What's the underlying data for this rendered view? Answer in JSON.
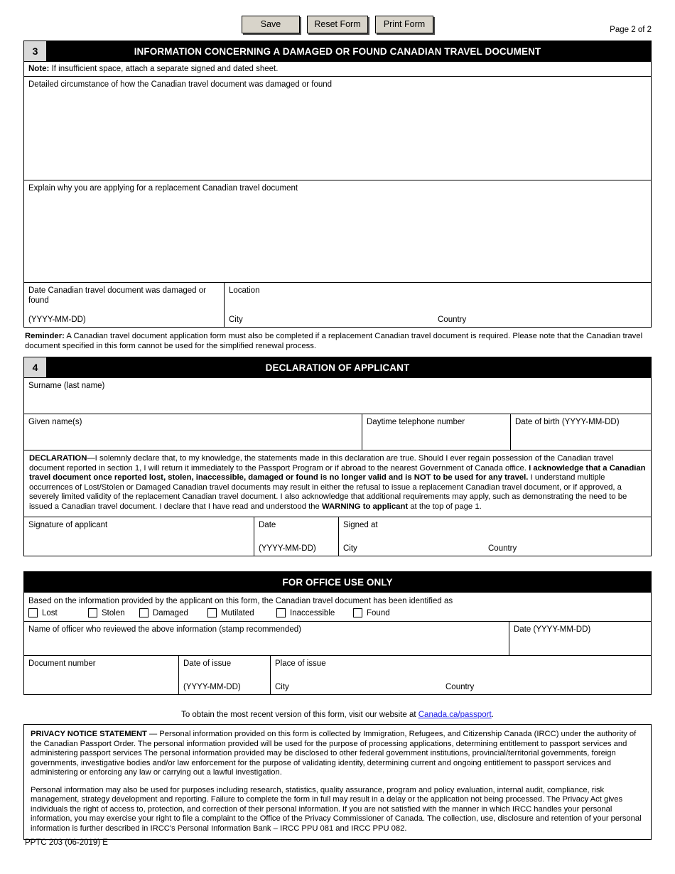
{
  "toolbar": {
    "save_label": "Save",
    "reset_label": "Reset Form",
    "print_label": "Print Form"
  },
  "page_indicator": "Page 2 of 2",
  "section3": {
    "number": "3",
    "title": "INFORMATION CONCERNING A DAMAGED OR FOUND CANADIAN TRAVEL DOCUMENT",
    "note_bold": "Note:",
    "note_text": " If insufficient space, attach a separate signed and dated sheet.",
    "field_circumstance": "Detailed circumstance of how the Canadian travel document was damaged or found",
    "field_explain": "Explain why you are applying for a replacement Canadian travel document",
    "field_date_label": "Date Canadian travel document was damaged or found",
    "field_date_format": "(YYYY-MM-DD)",
    "field_location_label": "Location",
    "field_city": "City",
    "field_country": "Country"
  },
  "reminder": {
    "bold": "Reminder:",
    "text": " A Canadian travel document application form must also be completed if a replacement Canadian travel document is required. Please note that the Canadian travel document specified in this form cannot be used for the simplified renewal process."
  },
  "section4": {
    "number": "4",
    "title": "DECLARATION OF APPLICANT",
    "field_surname": "Surname (last name)",
    "field_given_names": "Given name(s)",
    "field_phone": "Daytime telephone number",
    "field_dob": "Date of birth (YYYY-MM-DD)",
    "declaration": {
      "b1": "DECLARATION",
      "t1": "—I solemnly declare that, to my knowledge, the statements made in this declaration are true. Should I ever regain possession of the Canadian travel document reported in section 1, I will return it immediately to the Passport Program or if abroad to the nearest Government of Canada office. ",
      "b2": "I acknowledge that a Canadian travel document once reported lost, stolen, inaccessible, damaged or found is no longer valid and is NOT to be used for any travel.",
      "t2": " I understand multiple occurrences of Lost/Stolen or Damaged Canadian travel documents may result in either the refusal to issue a replacement Canadian travel document, or if approved, a severely limited validity of the replacement Canadian travel document. I also acknowledge that additional requirements may apply, such as demonstrating the need to be issued a Canadian travel document. I declare that I have read and understood the ",
      "b3": "WARNING to applicant",
      "t3": " at the top of page 1."
    },
    "field_signature": "Signature of applicant",
    "field_date": "Date",
    "field_date_format": "(YYYY-MM-DD)",
    "field_signed_at": "Signed at",
    "field_city": "City",
    "field_country": "Country"
  },
  "office_use": {
    "title": "FOR OFFICE USE ONLY",
    "identified_text": "Based on the information provided by the applicant on this form, the Canadian travel document has been identified as",
    "checkboxes": [
      {
        "label": "Lost",
        "checked": false
      },
      {
        "label": "Stolen",
        "checked": false
      },
      {
        "label": "Damaged",
        "checked": false
      },
      {
        "label": "Mutilated",
        "checked": false
      },
      {
        "label": "Inaccessible",
        "checked": false
      },
      {
        "label": "Found",
        "checked": false
      }
    ],
    "field_officer": "Name of officer who reviewed the above information (stamp recommended)",
    "field_officer_date": "Date (YYYY-MM-DD)",
    "field_document_number": "Document number",
    "field_date_of_issue": "Date of issue",
    "field_date_of_issue_format": "(YYYY-MM-DD)",
    "field_place_of_issue": "Place of issue",
    "field_city": "City",
    "field_country": "Country"
  },
  "website_line": {
    "prefix": "To obtain the most recent version of this form, visit our website at  ",
    "link": "Canada.ca/passport",
    "suffix": ".",
    "link_color": "#1a1ae6"
  },
  "privacy": {
    "heading": "PRIVACY NOTICE STATEMENT",
    "p1": " — Personal information provided on this form is collected by Immigration, Refugees, and Citizenship Canada (IRCC) under the authority of the Canadian Passport Order. The personal information provided will be used for the purpose of processing applications, determining entitlement to passport services and administering passport services The personal information provided may be disclosed to other federal government institutions, provincial/territorial governments, foreign governments, investigative bodies and/or law enforcement for the purpose of validating identity, determining current and ongoing entitlement to passport services and administering or enforcing any law or carrying out a lawful investigation.",
    "p2": "Personal information may also be used for purposes including research, statistics, quality assurance, program and policy evaluation, internal audit, compliance, risk management, strategy development and reporting. Failure to complete the form in full may result in a delay or the application not being processed. The Privacy Act gives individuals the right of access to, protection, and correction of their personal information. If you are not satisfied with the manner in which IRCC handles your personal information, you may exercise your right to file a complaint to the Office of the Privacy Commissioner of Canada. The collection, use, disclosure and retention of your personal information is further described in IRCC's Personal Information Bank – IRCC PPU 081 and IRCC PPU 082."
  },
  "footer_code": "PPTC 203 (06-2019) E"
}
